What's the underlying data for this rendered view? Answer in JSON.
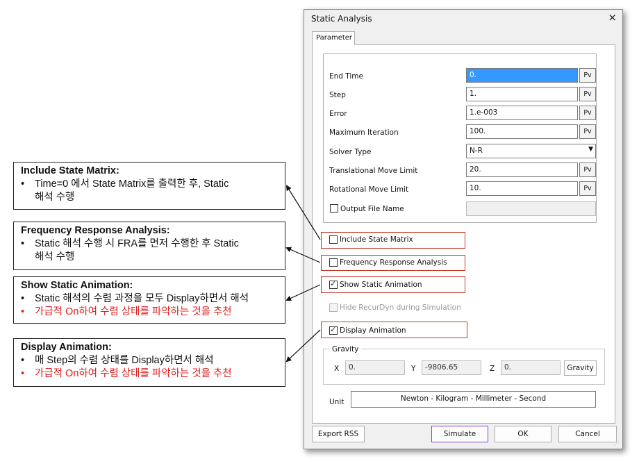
{
  "notes": [
    {
      "title": "Include State Matrix:",
      "lines": [
        {
          "t": "Time=0 에서 State Matrix를 출력한 후, Static",
          "t2": "해석 수행",
          "red": false
        }
      ]
    },
    {
      "title": "Frequency Response Analysis:",
      "lines": [
        {
          "t": "Static 해석 수행 시 FRA를 먼저 수행한 후 Static",
          "t2": "해석 수행",
          "red": false
        }
      ]
    },
    {
      "title": "Show Static Animation:",
      "lines": [
        {
          "t": "Static 해석의 수렴 과정을 모두 Display하면서 해석",
          "red": false
        },
        {
          "t": "가급적 On하여 수렴 상태를 파악하는 것을 추천",
          "red": true
        }
      ]
    },
    {
      "title": "Display Animation:",
      "lines": [
        {
          "t": "매 Step의 수렴 상태를 Display하면서 해석",
          "red": false
        },
        {
          "t": "가급적 On하여 수렴 상태를 파악하는 것을 추천",
          "red": true
        }
      ]
    }
  ],
  "bullet": "•",
  "dialog": {
    "title": "Static Analysis",
    "close": "×",
    "tab": "Parameter",
    "pv_label": "Pv",
    "params": [
      {
        "label": "End Time",
        "value": "0."
      },
      {
        "label": "Step",
        "value": "1."
      },
      {
        "label": "Error",
        "value": "1.e-003"
      },
      {
        "label": "Maximum Iteration",
        "value": "100."
      }
    ],
    "solver": {
      "label": "Solver Type",
      "value": "N-R"
    },
    "limits": [
      {
        "label": "Translational Move Limit",
        "value": "20."
      },
      {
        "label": "Rotational Move Limit",
        "value": "10."
      }
    ],
    "output_file": {
      "label": "Output File Name",
      "value": ""
    },
    "options": [
      {
        "label": "Include State Matrix",
        "checked": false
      },
      {
        "label": "Frequency Response Analysis",
        "checked": false
      },
      {
        "label": "Show Static Animation",
        "checked": true
      },
      {
        "label": "Hide RecurDyn during Simulation",
        "checked": false
      },
      {
        "label": "Display Animation",
        "checked": true
      }
    ],
    "gravity": {
      "title": "Gravity",
      "x_label": "X",
      "x": "0.",
      "y_label": "Y",
      "y": "-9806.65",
      "z_label": "Z",
      "z": "0.",
      "button": "Gravity"
    },
    "unit": {
      "label": "Unit",
      "value": "Newton - Kilogram - Millimeter - Second"
    },
    "buttons": {
      "export": "Export RSS",
      "simulate": "Simulate",
      "ok": "OK",
      "cancel": "Cancel"
    }
  },
  "colors": {
    "highlight": "#c0392b",
    "note_red": "#e02020",
    "selected": "#3399ff"
  }
}
